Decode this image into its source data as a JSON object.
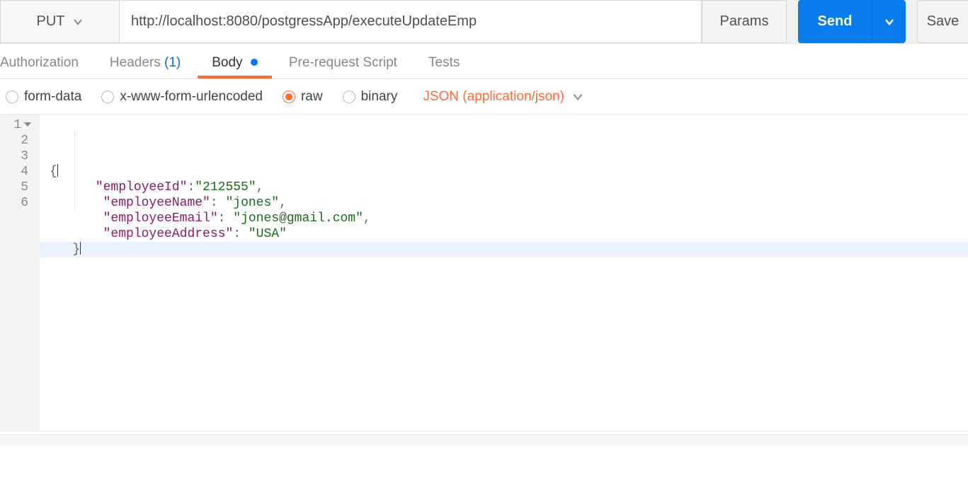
{
  "request": {
    "method": "PUT",
    "url": "http://localhost:8080/postgressApp/executeUpdateEmp",
    "params_label": "Params",
    "send_label": "Send",
    "save_label": "Save"
  },
  "tabs": {
    "authorization": "Authorization",
    "headers": "Headers",
    "headers_count": "(1)",
    "body": "Body",
    "prerequest": "Pre-request Script",
    "tests": "Tests",
    "active": "body"
  },
  "body_types": {
    "form_data": "form-data",
    "urlencoded": "x-www-form-urlencoded",
    "raw": "raw",
    "binary": "binary",
    "selected": "raw",
    "content_type": "JSON (application/json)"
  },
  "editor": {
    "line_numbers": [
      "1",
      "2",
      "3",
      "4",
      "5",
      "6"
    ],
    "lines": [
      {
        "tokens": [
          {
            "t": "punc",
            "v": "{"
          }
        ],
        "caret_after": true
      },
      {
        "indent": "      ",
        "tokens": [
          {
            "t": "key",
            "v": "\"employeeId\""
          },
          {
            "t": "punc",
            "v": ":"
          },
          {
            "t": "str",
            "v": "\"212555\""
          },
          {
            "t": "punc",
            "v": ","
          }
        ]
      },
      {
        "indent": "       ",
        "tokens": [
          {
            "t": "key",
            "v": "\"employeeName\""
          },
          {
            "t": "punc",
            "v": ": "
          },
          {
            "t": "str",
            "v": "\"jones\""
          },
          {
            "t": "punc",
            "v": ","
          }
        ]
      },
      {
        "indent": "       ",
        "tokens": [
          {
            "t": "key",
            "v": "\"employeeEmail\""
          },
          {
            "t": "punc",
            "v": ": "
          },
          {
            "t": "str",
            "v": "\"jones@gmail.com\""
          },
          {
            "t": "punc",
            "v": ","
          }
        ]
      },
      {
        "indent": "       ",
        "tokens": [
          {
            "t": "key",
            "v": "\"employeeAddress\""
          },
          {
            "t": "punc",
            "v": ": "
          },
          {
            "t": "str",
            "v": "\"USA\""
          }
        ]
      },
      {
        "indent": "   ",
        "tokens": [
          {
            "t": "punc",
            "v": "}"
          }
        ],
        "highlight": true,
        "caret_after": true
      }
    ]
  }
}
